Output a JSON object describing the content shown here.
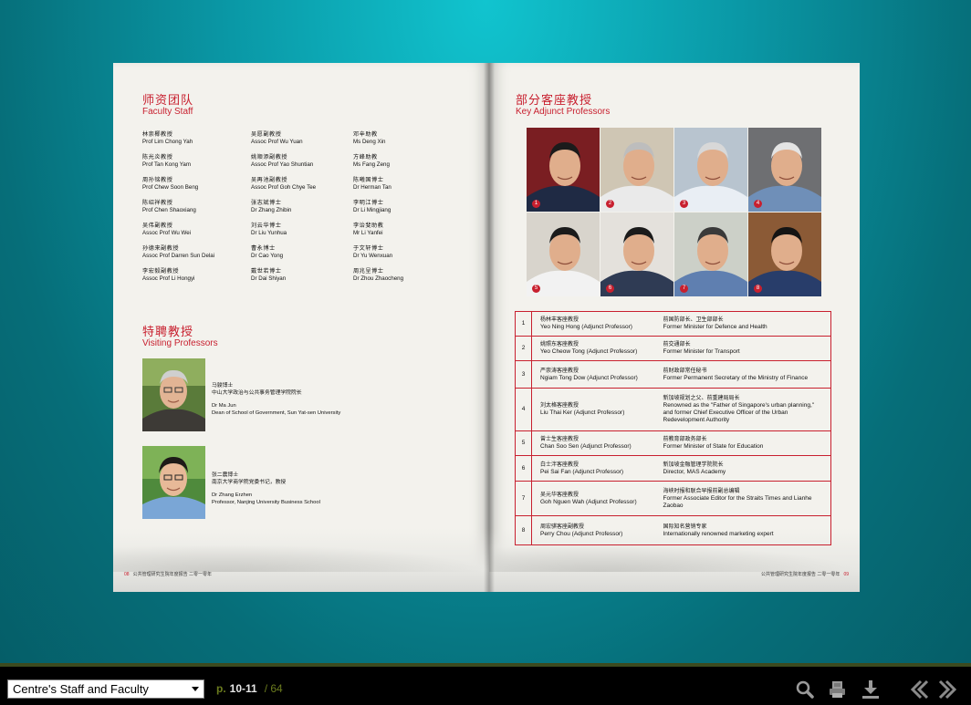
{
  "left_page": {
    "faculty": {
      "title_cn": "师资团队",
      "title_en": "Faculty Staff",
      "members": [
        {
          "cn": "林崇椰教授",
          "en": "Prof Lim Chong Yah"
        },
        {
          "cn": "吴愿副教授",
          "en": "Assoc Prof Wu Yuan"
        },
        {
          "cn": "邓辛助教",
          "en": "Ms Deng Xin"
        },
        {
          "cn": "陈光炎教授",
          "en": "Prof Tan Kong Yam"
        },
        {
          "cn": "姚顺添副教授",
          "en": "Assoc Prof Yao Shuntian"
        },
        {
          "cn": "方峰助教",
          "en": "Ms Fang Zeng"
        },
        {
          "cn": "周孙铭教授",
          "en": "Prof Chew Soon Beng"
        },
        {
          "cn": "吴再池副教授",
          "en": "Assoc Prof Goh Chye Tee"
        },
        {
          "cn": "陈曦国博士",
          "en": "Dr Herman Tan"
        },
        {
          "cn": "陈绍祥教授",
          "en": "Prof Chen Shaoxiang"
        },
        {
          "cn": "张志斌博士",
          "en": "Dr Zhang Zhibin"
        },
        {
          "cn": "李明江博士",
          "en": "Dr Li Mingjiang"
        },
        {
          "cn": "吴伟副教授",
          "en": "Assoc Prof Wu Wei"
        },
        {
          "cn": "刘云华博士",
          "en": "Dr Liu Yunhua"
        },
        {
          "cn": "李诒斐助教",
          "en": "Mr Li Yanfei"
        },
        {
          "cn": "孙德来副教授",
          "en": "Assoc Prof Darren Sun Delai"
        },
        {
          "cn": "曹永博士",
          "en": "Dr Cao Yong"
        },
        {
          "cn": "于文轩博士",
          "en": "Dr Yu Wenxuan"
        },
        {
          "cn": "李宏毅副教授",
          "en": "Assoc Prof Li Hongyi"
        },
        {
          "cn": "戴世若博士",
          "en": "Dr Dai Shiyan"
        },
        {
          "cn": "周兆呈博士",
          "en": "Dr Zhou Zhaocheng"
        }
      ]
    },
    "visiting": {
      "title_cn": "特聘教授",
      "title_en": "Visiting Professors",
      "people": [
        {
          "cn_name": "马骏博士",
          "cn_role": "中山大学政治与公共事务管理学院院长",
          "en_name": "Dr Ma Jun",
          "en_role": "Dean of School of Government, Sun Yat-sen University"
        },
        {
          "cn_name": "张二震博士",
          "cn_role": "南京大学商学院党委书记，教授",
          "en_name": "Dr Zhang Erzhen",
          "en_role": "Professor, Nanjing University Business School"
        }
      ]
    },
    "footer": {
      "page": "08",
      "text": "公共管理研究生院年度报告 二零一零年"
    }
  },
  "right_page": {
    "title_cn": "部分客座教授",
    "title_en": "Key Adjunct Professors",
    "photo_numbers": [
      "1",
      "2",
      "3",
      "4",
      "5",
      "6",
      "7",
      "8"
    ],
    "professors": [
      {
        "no": "1",
        "cn": "杨林丰客座教授",
        "en": "Yeo Ning Hong (Adjunct Professor)",
        "desc_cn": "前国防部长、卫生部部长",
        "desc_en": "Former Minister for Defence and Health"
      },
      {
        "no": "2",
        "cn": "姚照东客座教授",
        "en": "Yeo Cheow Tong (Adjunct Professor)",
        "desc_cn": "前交通部长",
        "desc_en": "Former Minister for Transport"
      },
      {
        "no": "3",
        "cn": "严崇涛客座教授",
        "en": "Ngiam Tong Dow (Adjunct Professor)",
        "desc_cn": "前财政部常任秘书",
        "desc_en": "Former Permanent Secretary of the Ministry of Finance"
      },
      {
        "no": "4",
        "cn": "刘太格客座教授",
        "en": "Liu Thai Ker (Adjunct Professor)",
        "desc_cn": "新加坡规划之父、前重建局局长",
        "desc_en": "Renowned as the \"Father of Singapore's urban planning,\" and former Chief Executive Officer of the Urban Redevelopment Authority"
      },
      {
        "no": "5",
        "cn": "曾士生客座教授",
        "en": "Chan Soo Sen (Adjunct Professor)",
        "desc_cn": "前教育部政务部长",
        "desc_en": "Former Minister of State for Education"
      },
      {
        "no": "6",
        "cn": "白士泮客座教授",
        "en": "Pei Sai Fan (Adjunct Professor)",
        "desc_cn": "新加坡金融管理学院院长",
        "desc_en": "Director, MAS Academy"
      },
      {
        "no": "7",
        "cn": "吴元华客座教授",
        "en": "Goh Nguen Wah (Adjunct Professor)",
        "desc_cn": "海峡时报和联合早报前副总编辑",
        "desc_en": "Former Associate Editor for the Straits Times and Lianhe Zaobao"
      },
      {
        "no": "8",
        "cn": "周宏骐客座副教授",
        "en": "Perry Chou (Adjunct Professor)",
        "desc_cn": "国际知名营销专家",
        "desc_en": "Internationally renowned marketing expert"
      }
    ],
    "footer": {
      "page": "09",
      "text": "公共管理研究生院年度报告 二零一零年"
    }
  },
  "toolbar": {
    "chapter_selected": "Centre's Staff and Faculty",
    "page_prefix": "p.",
    "current_pages": "10-11",
    "total_pages": "/ 64",
    "icons": [
      "search-icon",
      "print-icon",
      "download-icon",
      "prev-page-icon",
      "next-page-icon"
    ]
  }
}
